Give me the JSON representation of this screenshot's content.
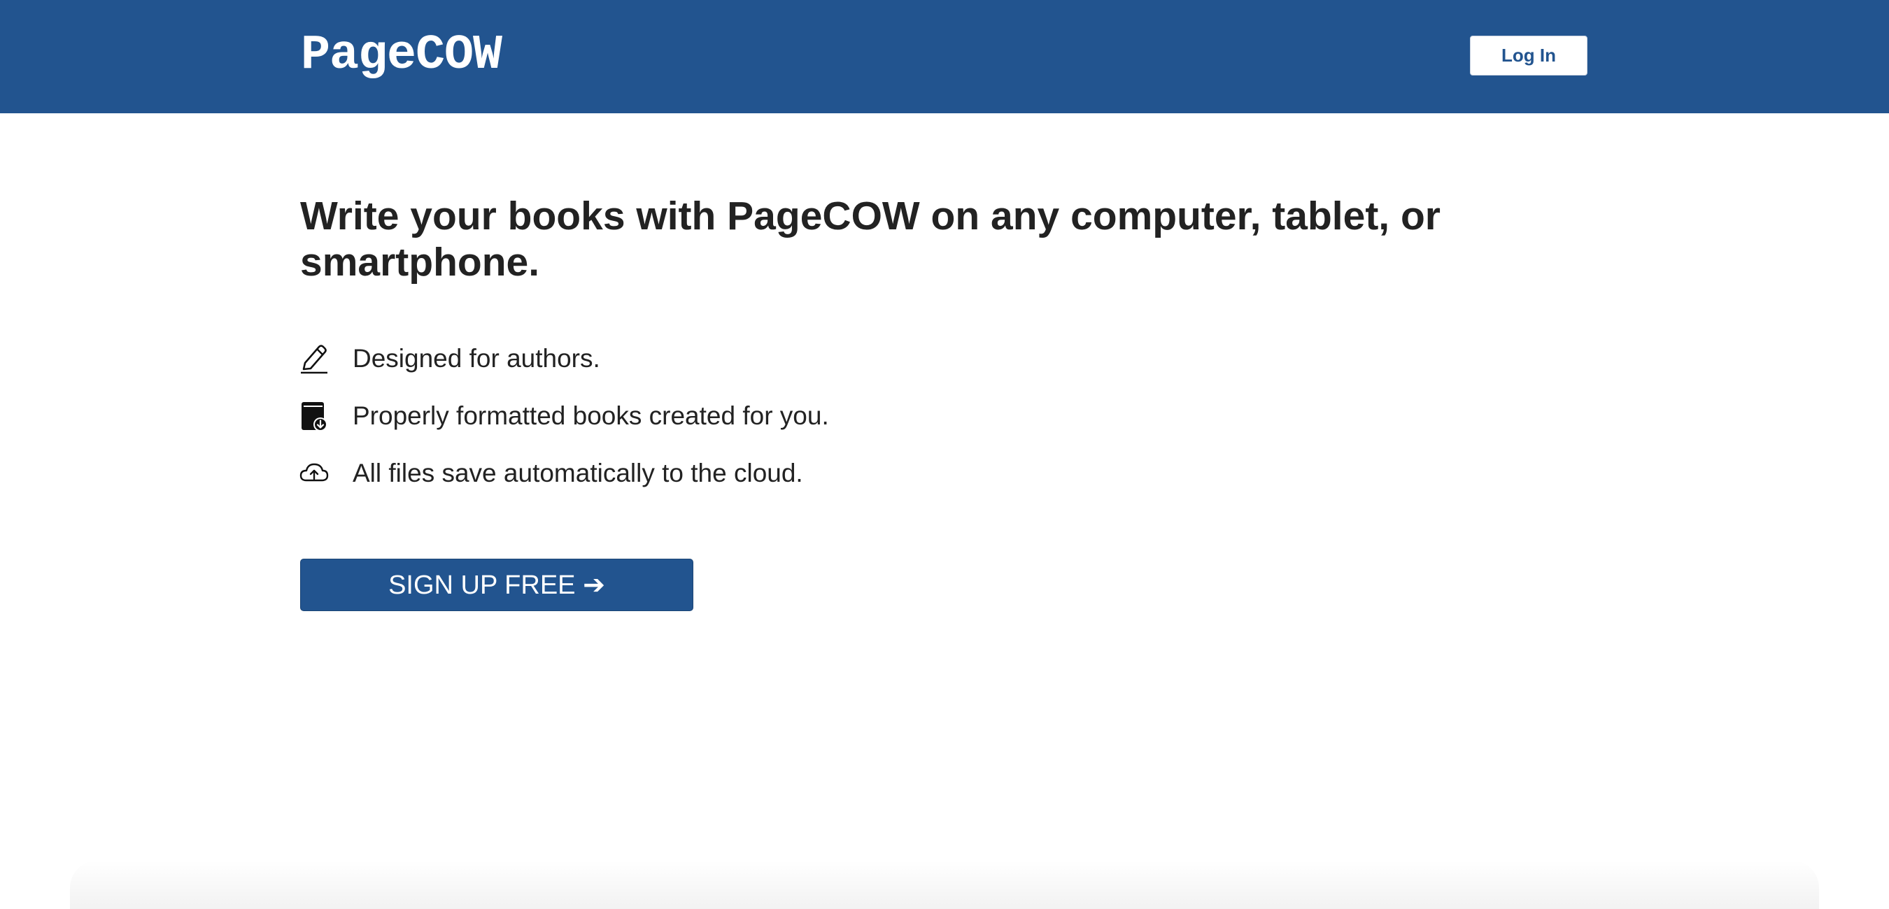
{
  "header": {
    "logo": "PageCOW",
    "login_label": "Log In",
    "background_color": "#22548f"
  },
  "hero": {
    "heading": "Write your books with PageCOW on any computer, tablet, or smartphone."
  },
  "features": [
    {
      "icon": "pencil-icon",
      "text": "Designed for authors."
    },
    {
      "icon": "book-download-icon",
      "text": "Properly formatted books created for you."
    },
    {
      "icon": "cloud-upload-icon",
      "text": "All files save automatically to the cloud."
    }
  ],
  "cta": {
    "signup_label": "SIGN UP FREE ➔",
    "color": "#22548f"
  }
}
